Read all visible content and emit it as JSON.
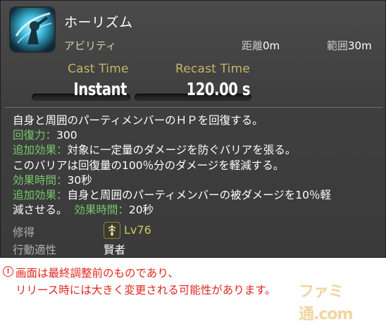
{
  "skill": {
    "name": "ホーリズム",
    "type": "アビリティ",
    "distance_label": "距離",
    "distance_value": "0m",
    "range_label": "範囲",
    "range_value": "30m",
    "icon": "holism-skill-icon"
  },
  "timing": {
    "cast_label": "Cast Time",
    "cast_value": "Instant",
    "recast_label": "Recast Time",
    "recast_value": "120.00 s"
  },
  "description": {
    "line1": "自身と周囲のパーティメンバーのＨＰを回復する。",
    "potency_label": "回復力：",
    "potency_value": "300",
    "effect1_label": "追加効果：",
    "effect1_text": "対象に一定量のダメージを防ぐバリアを張る。",
    "line4": "このバリアは回復量の100％分のダメージを軽減する。",
    "duration1_label": "効果時間：",
    "duration1_value": "30秒",
    "effect2_label": "追加効果：",
    "effect2_text_a": "自身と周囲のパーティメンバーの被ダメージを10％軽",
    "effect2_text_b": "減させる。",
    "duration2_label": "効果時間：",
    "duration2_value": "20秒"
  },
  "meta": {
    "acquired_label": "修得",
    "acquired_level": "Lv76",
    "job_label": "行動適性",
    "job_value": "賢者",
    "job_icon": "sage-job-icon"
  },
  "notice": {
    "line1": "画面は最終調整前のものであり、",
    "line2": "リリース時には大きく変更される可能性があります。",
    "icon_glyph": "!"
  },
  "watermark": {
    "text": "ファミ通.com"
  },
  "colors": {
    "panel": "#3f3f3f",
    "label_gold": "#c6b46a",
    "effect_green": "#76c96a",
    "notice_red": "#e0271e",
    "level_yellow": "#c9c95a"
  }
}
